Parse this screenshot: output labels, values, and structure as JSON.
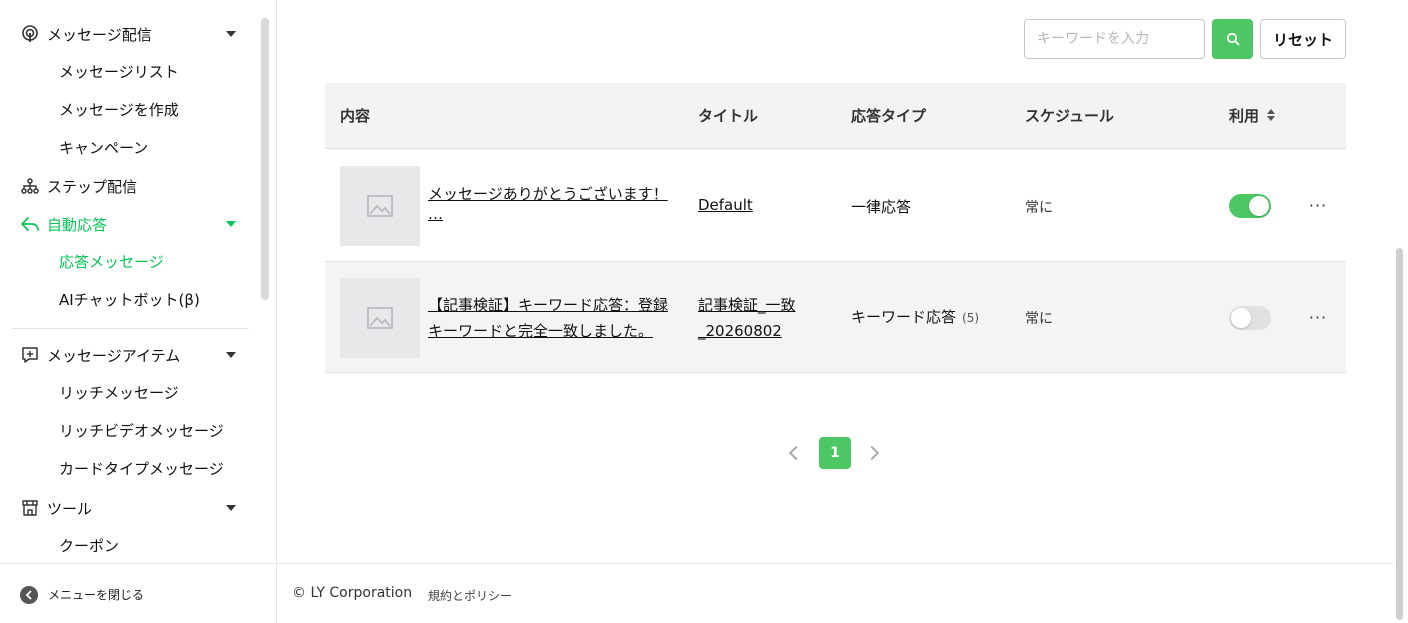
{
  "sidebar": {
    "groups": [
      {
        "label": "メッセージ配信",
        "icon": "broadcast-icon"
      },
      {
        "label": "ステップ配信",
        "icon": "hierarchy-icon"
      },
      {
        "label": "自動応答",
        "icon": "reply-icon"
      },
      {
        "label": "メッセージアイテム",
        "icon": "plus-square-icon"
      },
      {
        "label": "ツール",
        "icon": "store-icon"
      }
    ],
    "items": [
      {
        "label": "メッセージリスト"
      },
      {
        "label": "メッセージを作成"
      },
      {
        "label": "キャンペーン"
      },
      {
        "label": "応答メッセージ"
      },
      {
        "label": "AIチャットボット(β)"
      },
      {
        "label": "リッチメッセージ"
      },
      {
        "label": "リッチビデオメッセージ"
      },
      {
        "label": "カードタイプメッセージ"
      },
      {
        "label": "クーポン"
      }
    ],
    "close_label": "メニューを閉じる",
    "accent": "#06c755"
  },
  "search": {
    "placeholder": "キーワードを入力",
    "reset_label": "リセット"
  },
  "table": {
    "headers": {
      "content": "内容",
      "title": "タイトル",
      "type": "応答タイプ",
      "schedule": "スケジュール",
      "enabled": "利用"
    },
    "rows": [
      {
        "content_line1": "メッセージありがとうございます！",
        "content_line2": "…",
        "title_line1": "Default",
        "title_line2": "",
        "type": "一律応答",
        "type_count": "",
        "schedule": "常に",
        "enabled": true
      },
      {
        "content_line1": "【記事検証】キーワード応答：登録",
        "content_line2": "キーワードと完全一致しました。",
        "title_line1": "記事検証_一致",
        "title_line2": "_20260802",
        "type": "キーワード応答",
        "type_count": "(5)",
        "schedule": "常に",
        "enabled": false
      }
    ]
  },
  "pagination": {
    "current": "1"
  },
  "footer": {
    "copyright": "© LY Corporation",
    "policy": "規約とポリシー"
  },
  "colors": {
    "primary_green": "#4cc764"
  }
}
